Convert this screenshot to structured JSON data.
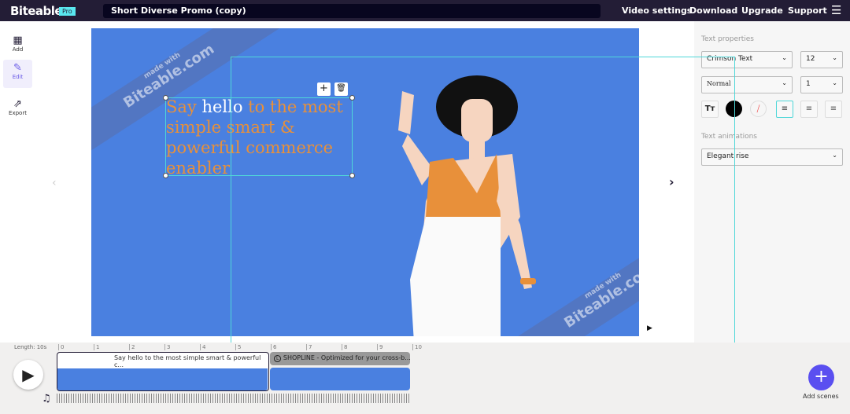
{
  "header": {
    "brand": "Biteable",
    "badge": "Pro",
    "project_title": "Short Diverse Promo (copy)",
    "nav": [
      "Video settings",
      "Download",
      "Upgrade",
      "Support"
    ]
  },
  "sidebar": {
    "items": [
      {
        "label": "Add",
        "icon": "grid-icon"
      },
      {
        "label": "Edit",
        "icon": "pencil-icon"
      },
      {
        "label": "Export",
        "icon": "export-icon"
      }
    ]
  },
  "canvas": {
    "text_parts": [
      "Say ",
      "hello",
      " to the most simple smart & powerful commerce enabler"
    ],
    "watermark_small": "made with",
    "watermark_large": "Biteable.com",
    "colors": {
      "background": "#4a80e0",
      "text": "#e8903a",
      "highlight": "#ffffff"
    }
  },
  "panel": {
    "text_properties_label": "Text properties",
    "font": "Crimson Text",
    "size": "12",
    "weight": "Normal",
    "line_height": "1",
    "text_animations_label": "Text animations",
    "animation": "Elegant rise"
  },
  "timeline": {
    "length": "Length: 10s",
    "ticks": [
      "0",
      "1",
      "2",
      "3",
      "4",
      "5",
      "6",
      "7",
      "8",
      "9",
      "10"
    ],
    "scene1": "Say hello to the most simple smart & powerful c...",
    "scene2": "SHOPLINE - Optimized for your cross-b...",
    "scene2_icon": "L",
    "add_scenes": "Add scenes"
  }
}
